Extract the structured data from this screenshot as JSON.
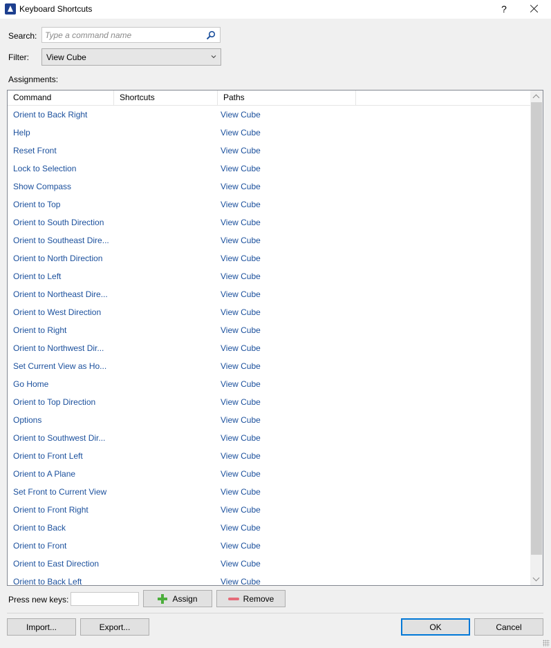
{
  "window": {
    "title": "Keyboard Shortcuts",
    "help_glyph": "?",
    "icon": "revit-app-icon"
  },
  "search": {
    "label": "Search:",
    "placeholder": "Type a command name",
    "value": "",
    "icon": "search-icon"
  },
  "filter": {
    "label": "Filter:",
    "selected": "View Cube"
  },
  "assignments": {
    "label": "Assignments:",
    "columns": [
      "Command",
      "Shortcuts",
      "Paths"
    ],
    "rows": [
      {
        "command": "Orient to Back Right",
        "shortcut": "",
        "path": "View Cube"
      },
      {
        "command": "Help",
        "shortcut": "",
        "path": "View Cube"
      },
      {
        "command": "Reset Front",
        "shortcut": "",
        "path": "View Cube"
      },
      {
        "command": "Lock to Selection",
        "shortcut": "",
        "path": "View Cube"
      },
      {
        "command": "Show Compass",
        "shortcut": "",
        "path": "View Cube"
      },
      {
        "command": "Orient to Top",
        "shortcut": "",
        "path": "View Cube"
      },
      {
        "command": "Orient to South Direction",
        "shortcut": "",
        "path": "View Cube"
      },
      {
        "command": "Orient to Southeast Dire...",
        "shortcut": "",
        "path": "View Cube"
      },
      {
        "command": "Orient to North Direction",
        "shortcut": "",
        "path": "View Cube"
      },
      {
        "command": "Orient to Left",
        "shortcut": "",
        "path": "View Cube"
      },
      {
        "command": "Orient to Northeast Dire...",
        "shortcut": "",
        "path": "View Cube"
      },
      {
        "command": "Orient to West Direction",
        "shortcut": "",
        "path": "View Cube"
      },
      {
        "command": "Orient to Right",
        "shortcut": "",
        "path": "View Cube"
      },
      {
        "command": "Orient to Northwest Dir...",
        "shortcut": "",
        "path": "View Cube"
      },
      {
        "command": "Set Current View as Ho...",
        "shortcut": "",
        "path": "View Cube"
      },
      {
        "command": "Go Home",
        "shortcut": "",
        "path": "View Cube"
      },
      {
        "command": "Orient to Top Direction",
        "shortcut": "",
        "path": "View Cube"
      },
      {
        "command": "Options",
        "shortcut": "",
        "path": "View Cube"
      },
      {
        "command": "Orient to Southwest Dir...",
        "shortcut": "",
        "path": "View Cube"
      },
      {
        "command": "Orient to Front Left",
        "shortcut": "",
        "path": "View Cube"
      },
      {
        "command": "Orient to A Plane",
        "shortcut": "",
        "path": "View Cube"
      },
      {
        "command": "Set Front to Current View",
        "shortcut": "",
        "path": "View Cube"
      },
      {
        "command": "Orient to Front Right",
        "shortcut": "",
        "path": "View Cube"
      },
      {
        "command": "Orient to Back",
        "shortcut": "",
        "path": "View Cube"
      },
      {
        "command": "Orient to Front",
        "shortcut": "",
        "path": "View Cube"
      },
      {
        "command": "Orient to East Direction",
        "shortcut": "",
        "path": "View Cube"
      },
      {
        "command": "Orient to Back Left",
        "shortcut": "",
        "path": "View Cube"
      }
    ]
  },
  "new_keys": {
    "label": "Press new keys:",
    "value": "",
    "assign_label": "Assign",
    "remove_label": "Remove"
  },
  "footer": {
    "import_label": "Import...",
    "export_label": "Export...",
    "ok_label": "OK",
    "cancel_label": "Cancel"
  },
  "colors": {
    "link_text": "#1a4f9c",
    "ok_border": "#0078d7"
  }
}
